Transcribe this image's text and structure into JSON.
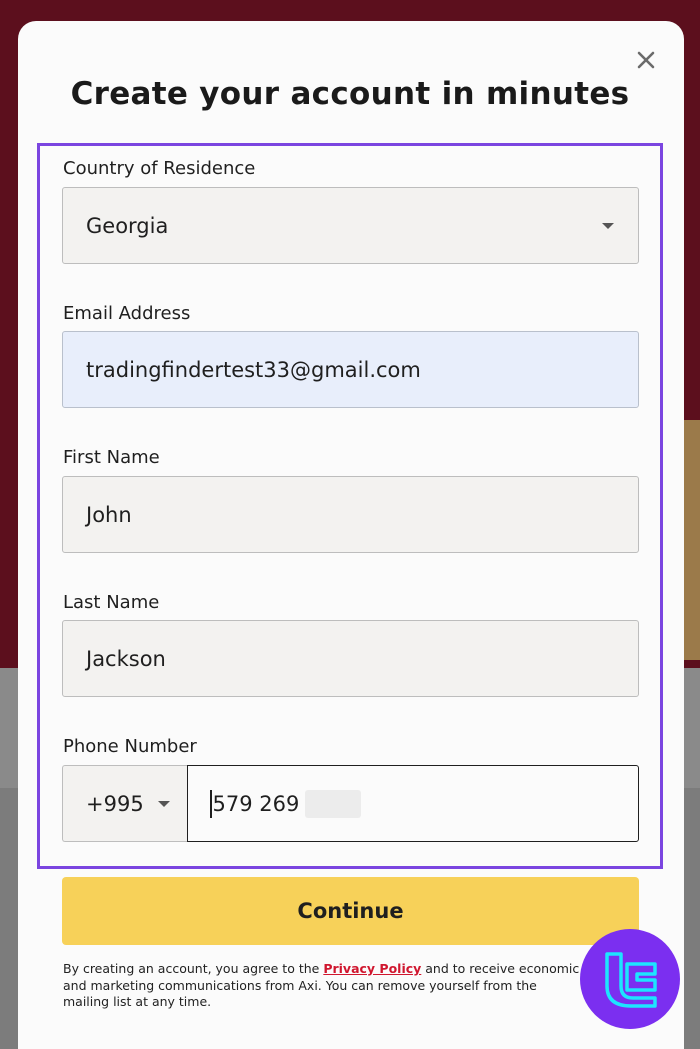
{
  "modal": {
    "title": "Create your account in minutes",
    "close_icon": "close-icon"
  },
  "form": {
    "country": {
      "label": "Country of Residence",
      "value": "Georgia"
    },
    "email": {
      "label": "Email Address",
      "value": "tradingfindertest33@gmail.com"
    },
    "first_name": {
      "label": "First Name",
      "value": "John"
    },
    "last_name": {
      "label": "Last Name",
      "value": "Jackson"
    },
    "phone": {
      "label": "Phone Number",
      "code": "+995",
      "value": "579 269"
    }
  },
  "actions": {
    "continue_label": "Continue"
  },
  "legal": {
    "prefix": "By creating an account, you agree to the ",
    "privacy_link": "Privacy Policy",
    "suffix": " and to receive economic and marketing communications from Axi. You can remove yourself from the mailing list at any time."
  },
  "colors": {
    "accent_border": "#7b45e0",
    "continue_button": "#f7d159",
    "link": "#d0162e"
  }
}
